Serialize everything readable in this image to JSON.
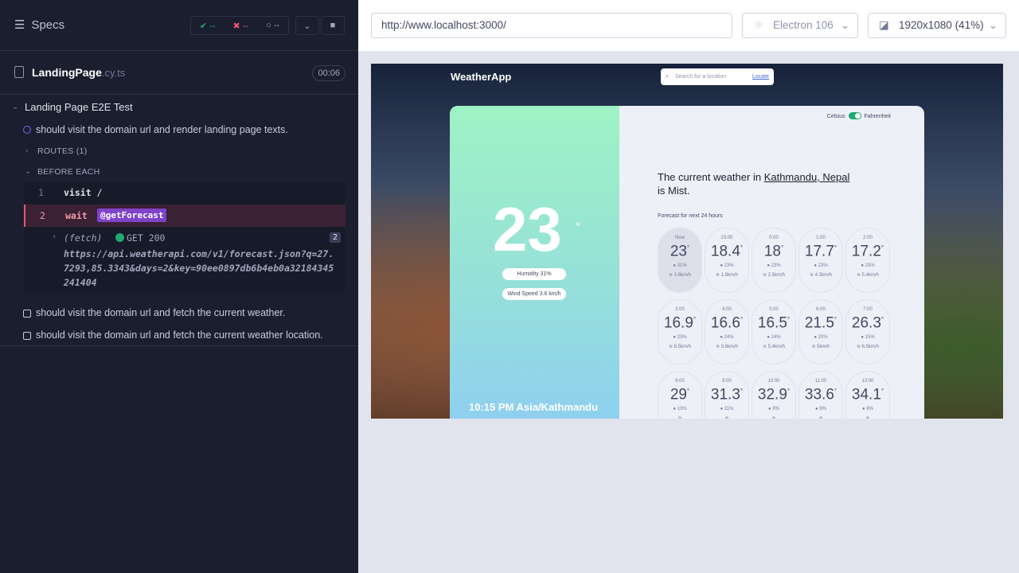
{
  "runner": {
    "title": "Specs",
    "stats": {
      "passed": "--",
      "failed": "--",
      "pending": "--"
    },
    "spec_name": "LandingPage",
    "spec_ext": ".cy.ts",
    "duration": "00:06",
    "suite": "Landing Page E2E Test",
    "tests": [
      "should visit the domain url and render landing page texts.",
      "should visit the domain url and fetch the current weather.",
      "should visit the domain url and fetch the current weather location."
    ],
    "routes": "ROUTES (1)",
    "before_each": "BEFORE EACH",
    "commands": [
      {
        "num": "1",
        "name": "visit",
        "arg": "/"
      },
      {
        "num": "2",
        "name": "wait",
        "arg": "@getForecast"
      }
    ],
    "fetch": {
      "label": "(fetch)",
      "status": "GET 200",
      "count": "2",
      "url": "https://api.weatherapi.com/v1/forecast.json?q=27.7293,85.3343&days=2&key=90ee0897db6b4eb0a32184345241404"
    }
  },
  "topbar": {
    "url": "http://www.localhost:3000/",
    "browser": "Electron 106",
    "viewport": "1920x1080  (41%)"
  },
  "app": {
    "logo": "WeatherApp",
    "search_placeholder": "Search for a location",
    "locate": "Locate",
    "temp": "23",
    "deg": "°",
    "humidity": "Humidity 31%",
    "wind": "Wind Speed 3.6 km/h",
    "clock": "10:15 PM Asia/Kathmandu",
    "toggle_c": "Celsius",
    "toggle_f": "Fahrenheit",
    "headline_pre": "The current weather in ",
    "location": "Kathmandu, Nepal",
    "headline_post": "is Mist.",
    "forecast_title": "Forecast for next 24 hours",
    "hours": [
      {
        "t": "Now",
        "temp": "23",
        "hum": "31%",
        "wind": "3.6km/h"
      },
      {
        "t": "23:00",
        "temp": "18.4",
        "hum": "23%",
        "wind": "1.8km/h"
      },
      {
        "t": "0:00",
        "temp": "18",
        "hum": "23%",
        "wind": "2.5km/h"
      },
      {
        "t": "1:00",
        "temp": "17.7",
        "hum": "23%",
        "wind": "4.3km/h"
      },
      {
        "t": "2:00",
        "temp": "17.2",
        "hum": "23%",
        "wind": "5.4km/h"
      },
      {
        "t": "3:00",
        "temp": "16.9",
        "hum": "23%",
        "wind": "6.5km/h"
      },
      {
        "t": "4:00",
        "temp": "16.6",
        "hum": "24%",
        "wind": "5.8km/h"
      },
      {
        "t": "5:00",
        "temp": "16.5",
        "hum": "24%",
        "wind": "5.4km/h"
      },
      {
        "t": "6:00",
        "temp": "21.5",
        "hum": "20%",
        "wind": "5km/h"
      },
      {
        "t": "7:00",
        "temp": "26.3",
        "hum": "15%",
        "wind": "6.5km/h"
      },
      {
        "t": "8:00",
        "temp": "29",
        "hum": "13%",
        "wind": ""
      },
      {
        "t": "9:00",
        "temp": "31.3",
        "hum": "11%",
        "wind": ""
      },
      {
        "t": "10:00",
        "temp": "32.9",
        "hum": "9%",
        "wind": ""
      },
      {
        "t": "11:00",
        "temp": "33.6",
        "hum": "9%",
        "wind": ""
      },
      {
        "t": "12:00",
        "temp": "34.1",
        "hum": "8%",
        "wind": ""
      }
    ]
  }
}
